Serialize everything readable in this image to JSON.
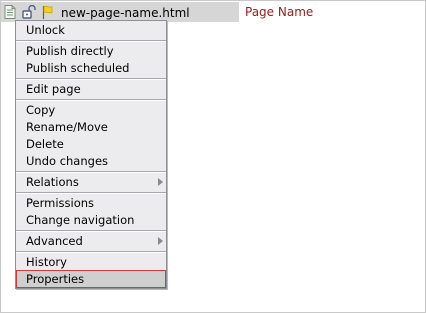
{
  "row": {
    "filename": "new-page-name.html",
    "page_title": "Page Name",
    "icons": [
      "page-icon",
      "unlock-icon",
      "flag-icon"
    ]
  },
  "menu": {
    "unlock": "Unlock",
    "publish_directly": "Publish directly",
    "publish_scheduled": "Publish scheduled",
    "edit_page": "Edit page",
    "copy": "Copy",
    "rename_move": "Rename/Move",
    "delete": "Delete",
    "undo_changes": "Undo changes",
    "relations": "Relations",
    "permissions": "Permissions",
    "change_navigation": "Change navigation",
    "advanced": "Advanced",
    "history": "History",
    "properties": "Properties"
  },
  "colors": {
    "title_red": "#9a1b1b",
    "menu_bg": "#ececee",
    "selected_border": "#d13a3a",
    "row_bar": "#d6d6d6"
  }
}
